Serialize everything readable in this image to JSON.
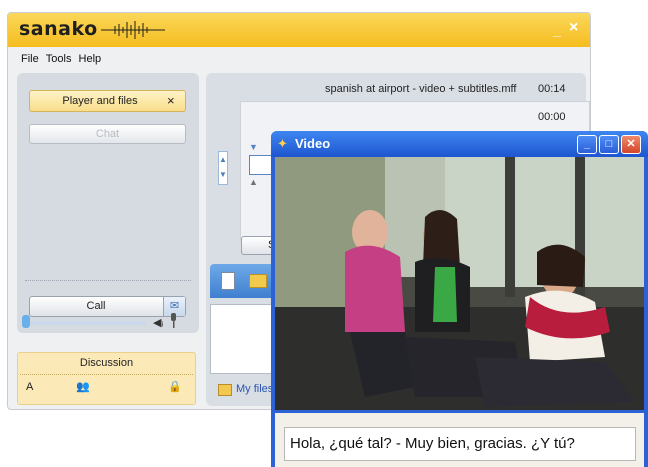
{
  "app": {
    "logo": "sanako",
    "menu": [
      "File",
      "Tools",
      "Help"
    ],
    "window_controls": {
      "minimize": "_",
      "close": "×"
    }
  },
  "left_panel": {
    "player_tab": {
      "label": "Player and files",
      "close": "×"
    },
    "chat_tab": {
      "label": "Chat"
    },
    "call_button": {
      "label": "Call"
    }
  },
  "discussion": {
    "title": "Discussion",
    "channel": "A"
  },
  "player": {
    "file_name": "spanish at airport - video + subtitles.mff",
    "duration": "00:14",
    "position": "00:00",
    "s_button": "S",
    "my_files": "My files"
  },
  "video_window": {
    "title": "Video",
    "subtitle": "Hola, ¿qué tal? - Muy bien, gracias. ¿Y tú?"
  },
  "colors": {
    "title_bar": "#f5bd1f",
    "video_title_bar": "#2d62d6",
    "discussion_bg": "#fbe9b7"
  }
}
